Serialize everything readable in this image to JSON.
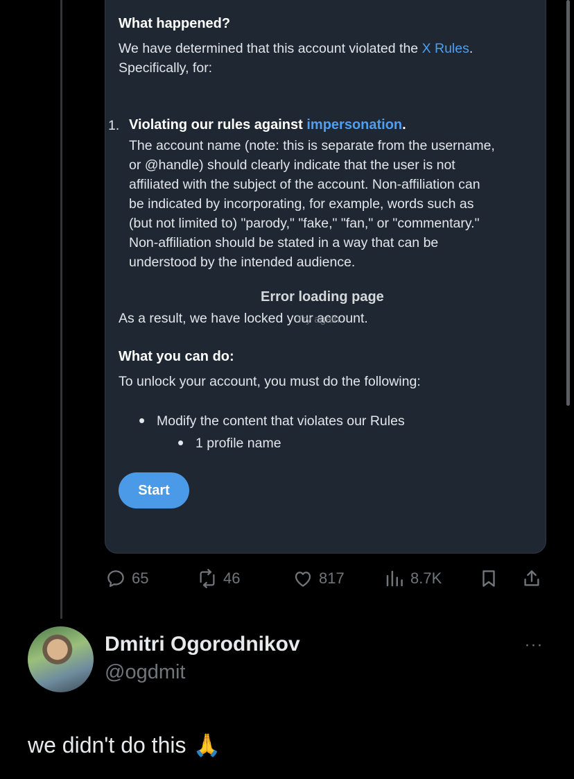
{
  "notice": {
    "what_happened_heading": "What happened?",
    "determined_text": "We have determined that this account violated the ",
    "rules_link": "X Rules",
    "determined_suffix": ".",
    "specifically": "Specifically, for:",
    "violation_number": "1.",
    "violation_title": "Violating our rules against ",
    "violation_link": "impersonation",
    "violation_suffix": ".",
    "violation_lines": [
      "The account name (note: this is separate from the username,",
      "or @handle) should clearly indicate that the user is not",
      "affiliated with the subject of the account. Non-affiliation can",
      "be indicated by incorporating, for example, words such as",
      "(but not limited to) \"parody,\" \"fake,\" \"fan,\" or \"commentary.\"",
      "Non-affiliation should be stated in a way that can be",
      "understood by the intended audience."
    ],
    "error_overlay": "Error loading page",
    "error_retry_hint": "Try again",
    "result_text": "As a result, we have locked your account.",
    "what_you_can_do_heading": "What you can do:",
    "unlock_text": "To unlock your account, you must do the following:",
    "bullet_1": "Modify the content that violates our Rules",
    "sub_bullet_1": "1 profile name",
    "start_button": "Start"
  },
  "actions": {
    "replies": "65",
    "reposts": "46",
    "likes": "817",
    "views": "8.7K"
  },
  "author": {
    "name": "Dmitri Ogorodnikov",
    "handle": "@ogdmit",
    "more": "···"
  },
  "tweet": {
    "text": "we didn't do this",
    "emoji": "🙏"
  }
}
